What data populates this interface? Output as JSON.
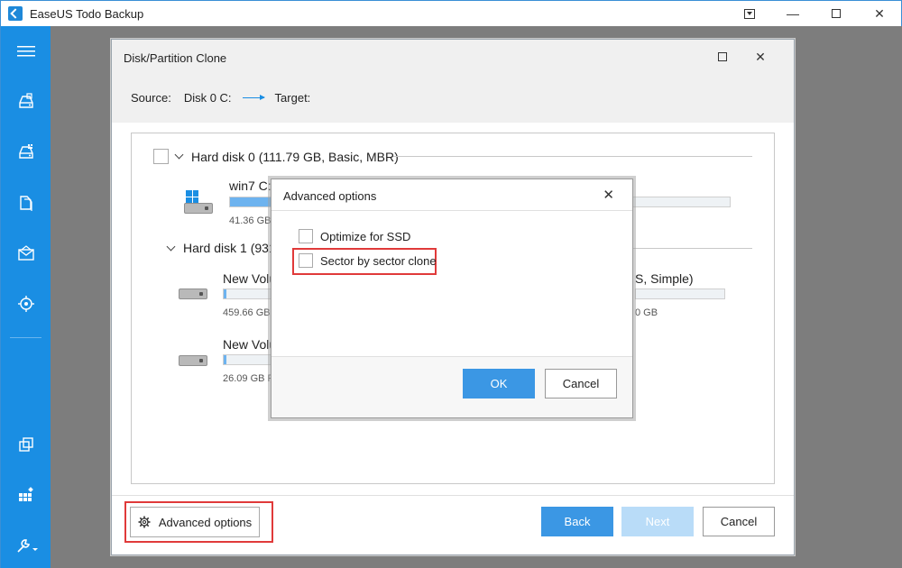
{
  "app": {
    "title": "EaseUS Todo Backup",
    "window_controls": [
      "dropdown",
      "minimize",
      "maximize",
      "close"
    ]
  },
  "sidebar": {
    "items": [
      {
        "icon": "menu-icon"
      },
      {
        "icon": "disk-backup-icon"
      },
      {
        "icon": "system-backup-icon"
      },
      {
        "icon": "file-backup-icon"
      },
      {
        "icon": "mail-backup-icon"
      },
      {
        "icon": "smart-backup-icon"
      },
      {
        "icon": "clone-icon"
      },
      {
        "icon": "apps-icon"
      },
      {
        "icon": "tools-icon"
      }
    ],
    "accent": "#1a8ee3"
  },
  "clone_dialog": {
    "title": "Disk/Partition Clone",
    "source_label": "Source:",
    "source_value": "Disk 0 C:",
    "target_label": "Target:",
    "disks": [
      {
        "label": "Hard disk 0 (111.79 GB, Basic, MBR)",
        "partitions": [
          {
            "name": "win7 C:",
            "size": "41.36 GB",
            "fill_percent": 40
          }
        ]
      },
      {
        "label": "Hard disk 1 (931",
        "partitions": [
          {
            "name": "New Volu",
            "size": "459.66 GB",
            "fill_percent": 1,
            "right_name": "S, Simple)",
            "right_size": "0 GB"
          },
          {
            "name": "New Volu",
            "size": "26.09 GB F",
            "fill_percent": 1
          }
        ]
      }
    ],
    "advanced_options_label": "Advanced options",
    "back_label": "Back",
    "next_label": "Next",
    "cancel_label": "Cancel"
  },
  "advanced_dialog": {
    "title": "Advanced options",
    "options": [
      {
        "label": "Optimize for SSD",
        "checked": false
      },
      {
        "label": "Sector by sector clone",
        "checked": false
      }
    ],
    "ok_label": "OK",
    "cancel_label": "Cancel"
  },
  "colors": {
    "primary_button": "#3b97e4",
    "disabled_button": "#b9dcf8",
    "highlight": "#e03a3a"
  }
}
